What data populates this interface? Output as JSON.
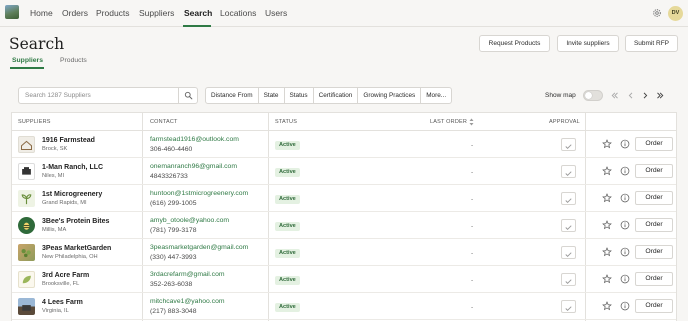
{
  "nav": {
    "items": [
      {
        "label": "Home"
      },
      {
        "label": "Orders"
      },
      {
        "label": "Products"
      },
      {
        "label": "Suppliers"
      },
      {
        "label": "Search",
        "active": true
      },
      {
        "label": "Locations"
      },
      {
        "label": "Users"
      }
    ],
    "avatar_initials": "DV"
  },
  "header": {
    "title": "Search",
    "buttons": [
      "Request Products",
      "Invite suppliers",
      "Submit RFP"
    ],
    "tabs": [
      {
        "label": "Suppliers",
        "active": true
      },
      {
        "label": "Products"
      }
    ]
  },
  "filters": {
    "search_placeholder": "Search 1287 Suppliers",
    "buttons": [
      "Distance From",
      "State",
      "Status",
      "Certification",
      "Growing Practices",
      "More..."
    ],
    "show_map_label": "Show map",
    "show_map_on": false
  },
  "table": {
    "columns": {
      "suppliers": "SUPPLIERS",
      "contact": "CONTACT",
      "status": "STATUS",
      "last_order": "LAST ORDER",
      "approval": "APPROVAL"
    },
    "order_label": "Order",
    "rows": [
      {
        "name": "1916 Farmstead",
        "location": "Brock, SK",
        "email": "farmstead1916@outlook.com",
        "phone": "306-460-4460",
        "status": "Active",
        "last_order": "-"
      },
      {
        "name": "1-Man Ranch, LLC",
        "location": "Niles, MI",
        "email": "onemanranch96@gmail.com",
        "phone": "4843326733",
        "status": "Active",
        "last_order": "-"
      },
      {
        "name": "1st Microgreenery",
        "location": "Grand Rapids, MI",
        "email": "huntoon@1stmicrogreenery.com",
        "phone": "(616) 299-1005",
        "status": "Active",
        "last_order": "-"
      },
      {
        "name": "3Bee's Protein Bites",
        "location": "Millis, MA",
        "email": "amyb_otoole@yahoo.com",
        "phone": "(781) 799-3178",
        "status": "Active",
        "last_order": "-"
      },
      {
        "name": "3Peas MarketGarden",
        "location": "New Philadelphia, OH",
        "email": "3peasmarketgarden@gmail.com",
        "phone": "(330) 447-3993",
        "status": "Active",
        "last_order": "-"
      },
      {
        "name": "3rd Acre Farm",
        "location": "Brooksville, FL",
        "email": "3rdacrefarm@gmail.com",
        "phone": "352-263-6038",
        "status": "Active",
        "last_order": "-"
      },
      {
        "name": "4 Lees Farm",
        "location": "Virginia, IL",
        "email": "mitchcave1@yahoo.com",
        "phone": "(217) 883-3048",
        "status": "Active",
        "last_order": "-"
      }
    ]
  },
  "colors": {
    "accent": "#2f7a45",
    "active_badge_bg": "#e4f1e2",
    "background": "#f7f6f4"
  }
}
